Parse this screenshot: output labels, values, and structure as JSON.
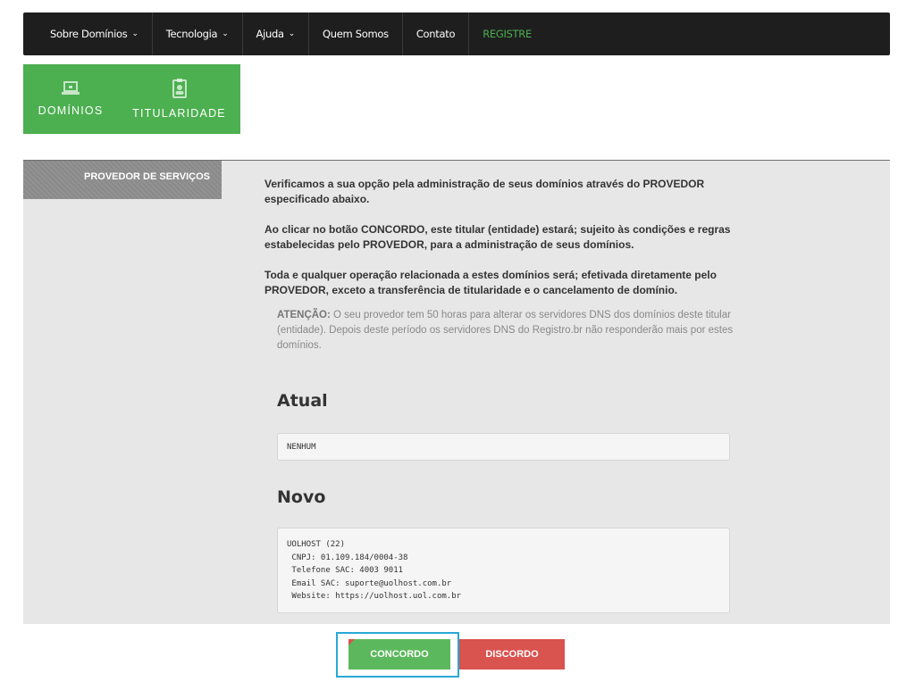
{
  "nav": {
    "items": [
      {
        "label": "Sobre Domínios",
        "dropdown": true
      },
      {
        "label": "Tecnologia",
        "dropdown": true
      },
      {
        "label": "Ajuda",
        "dropdown": true
      },
      {
        "label": "Quem Somos",
        "dropdown": false
      },
      {
        "label": "Contato",
        "dropdown": false
      },
      {
        "label": "REGISTRE",
        "dropdown": false
      }
    ],
    "chevron": "⌄"
  },
  "tiles": {
    "dominios": {
      "label": "DOMÍNIOS",
      "icon": "laptop-icon"
    },
    "titularidade": {
      "label": "TITULARIDADE",
      "icon": "badge-icon"
    },
    "color": "#4caf50"
  },
  "panel": {
    "side_tab": "PROVEDOR DE SERVIÇOS",
    "paragraphs": [
      "Verificamos a sua opção pela administração de seus domínios através do PROVEDOR especificado abaixo.",
      "Ao clicar no botão CONCORDO, este titular (entidade) estará; sujeito às condições e regras estabelecidas pelo PROVEDOR, para a administração de seus domínios.",
      "Toda e qualquer operação relacionada a estes domínios será; efetivada diretamente pelo PROVEDOR, exceto a transferência de titularidade e o cancelamento de domínio."
    ],
    "attention_label": "ATENÇÃO:",
    "attention_text": " O seu provedor tem 50 horas para alterar os servidores DNS dos domínios deste titular (entidade). Depois deste período os servidores DNS do Registro.br não responderão mais por estes domínios.",
    "atual": {
      "heading": "Atual",
      "value": "NENHUM"
    },
    "novo": {
      "heading": "Novo",
      "value": "UOLHOST (22)\n CNPJ: 01.109.184/0004-38\n Telefone SAC: 4003 9011\n Email SAC: suporte@uolhost.com.br\n Website: https://uolhost.uol.com.br"
    }
  },
  "actions": {
    "agree": "CONCORDO",
    "disagree": "DISCORDO",
    "agree_color": "#5cb85c",
    "disagree_color": "#d9534f"
  }
}
